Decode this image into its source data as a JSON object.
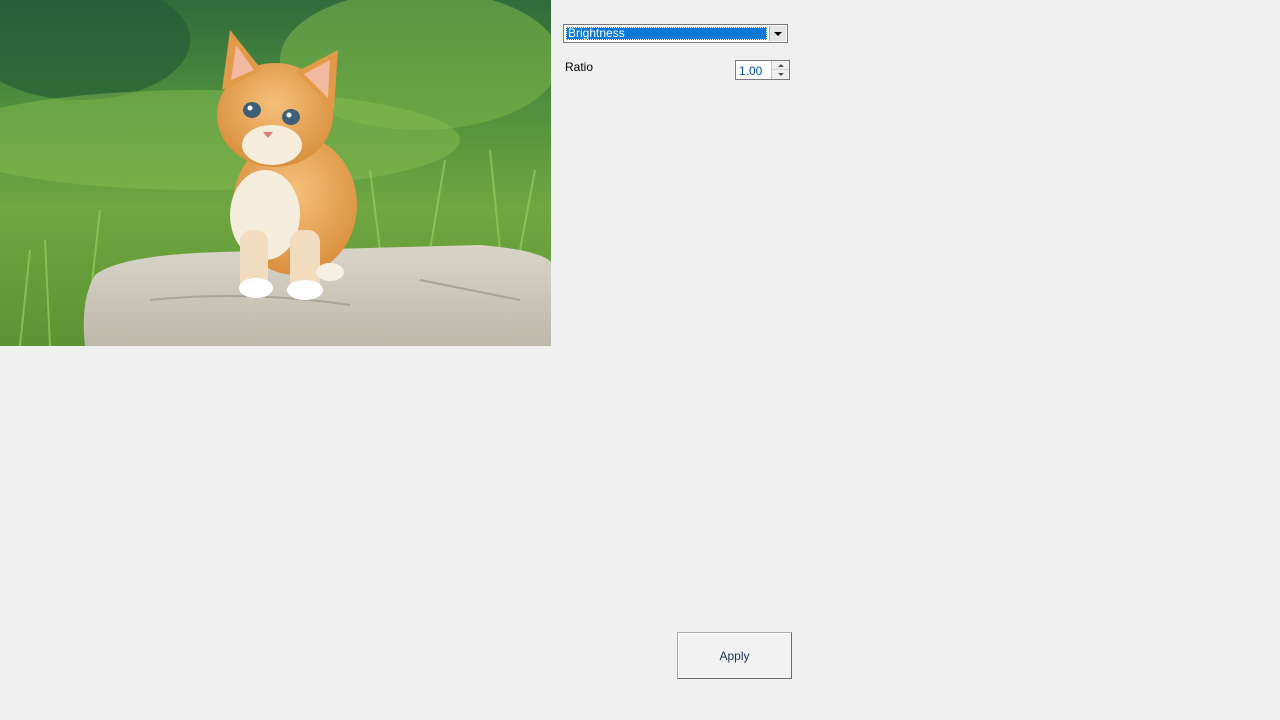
{
  "image": {
    "subject": "kitten"
  },
  "controls": {
    "filter_select": {
      "selected": "Brightness"
    },
    "ratio": {
      "label": "Ratio",
      "value": "1.00"
    },
    "apply_label": "Apply"
  },
  "colors": {
    "selection": "#0a78d7",
    "window_bg": "#f0f0f0"
  }
}
